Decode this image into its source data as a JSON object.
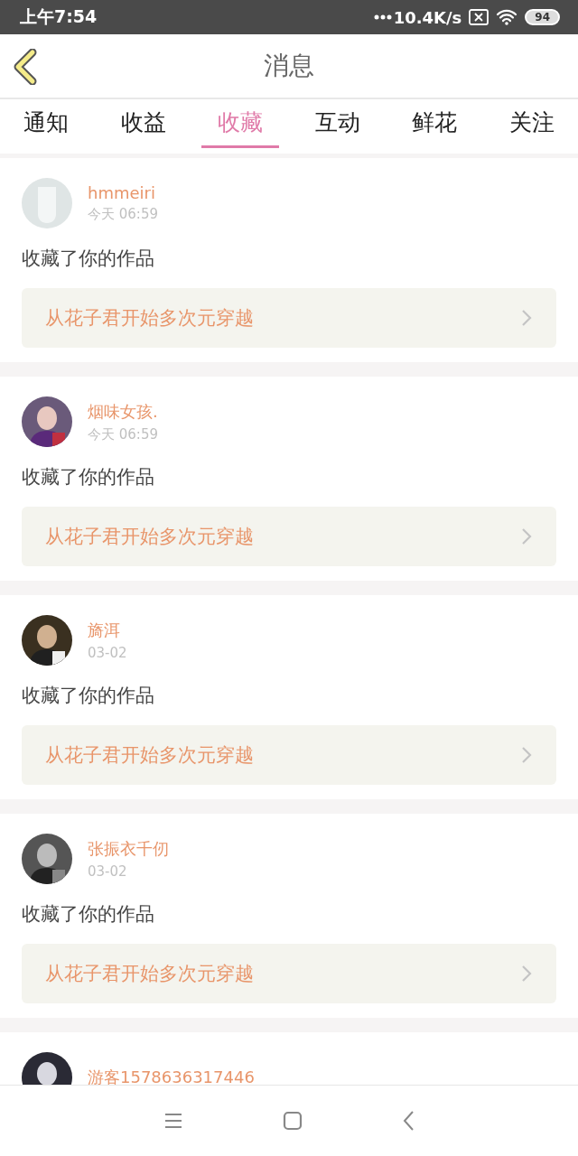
{
  "status_bar": {
    "time": "上午7:54",
    "speed": "10.4K/s",
    "battery": "94"
  },
  "header": {
    "title": "消息"
  },
  "tabs": [
    {
      "label": "通知",
      "selected": false
    },
    {
      "label": "收益",
      "selected": false
    },
    {
      "label": "收藏",
      "selected": true
    },
    {
      "label": "互动",
      "selected": false
    },
    {
      "label": "鲜花",
      "selected": false
    },
    {
      "label": "关注",
      "selected": false
    }
  ],
  "messages": [
    {
      "kind": "default",
      "name": "hmmeiri",
      "time": "今天 06:59",
      "action": "收藏了你的作品",
      "work": "从花子君开始多次元穿越"
    },
    {
      "kind": "picture",
      "name": "烟味女孩.",
      "time": "今天 06:59",
      "action": "收藏了你的作品",
      "work": "从花子君开始多次元穿越"
    },
    {
      "kind": "picture",
      "name": "旖洱",
      "time": "03-02",
      "action": "收藏了你的作品",
      "work": "从花子君开始多次元穿越"
    },
    {
      "kind": "picture",
      "name": "张振衣千仞",
      "time": "03-02",
      "action": "收藏了你的作品",
      "work": "从花子君开始多次元穿越"
    },
    {
      "kind": "picture",
      "name": "游客1578636317446"
    }
  ]
}
